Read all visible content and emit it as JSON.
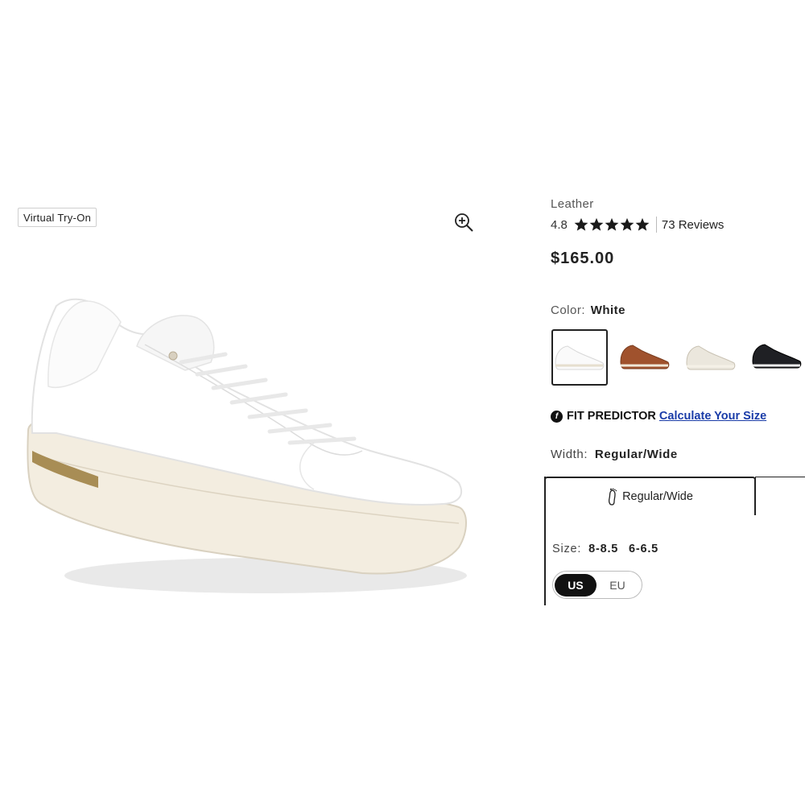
{
  "gallery": {
    "virtual_try_on_label": "Virtual Try-On",
    "zoom_icon": "zoom-in-icon"
  },
  "product": {
    "material": "Leather",
    "rating": "4.8",
    "rating_value": 4.8,
    "rating_max": 5,
    "reviews_label": "73 Reviews",
    "price": "$165.00"
  },
  "color": {
    "label": "Color:",
    "selected": "White",
    "swatches": [
      "white",
      "brown",
      "off-white",
      "black"
    ]
  },
  "fit_predictor": {
    "icon": "fit-predictor-icon",
    "title": "FIT PREDICTOR",
    "link": "Calculate Your Size"
  },
  "width": {
    "label": "Width:",
    "selected": "Regular/Wide",
    "tabs": [
      {
        "label": "Regular/Wide",
        "icon": "foot-icon"
      }
    ]
  },
  "size": {
    "label": "Size:",
    "values": [
      "8-8.5",
      "6-6.5"
    ],
    "units": {
      "us": "US",
      "eu": "EU",
      "selected": "US"
    }
  },
  "colors": {
    "link": "#1a3ca8",
    "star": "#1a1a1a",
    "selected_border": "#222222"
  }
}
